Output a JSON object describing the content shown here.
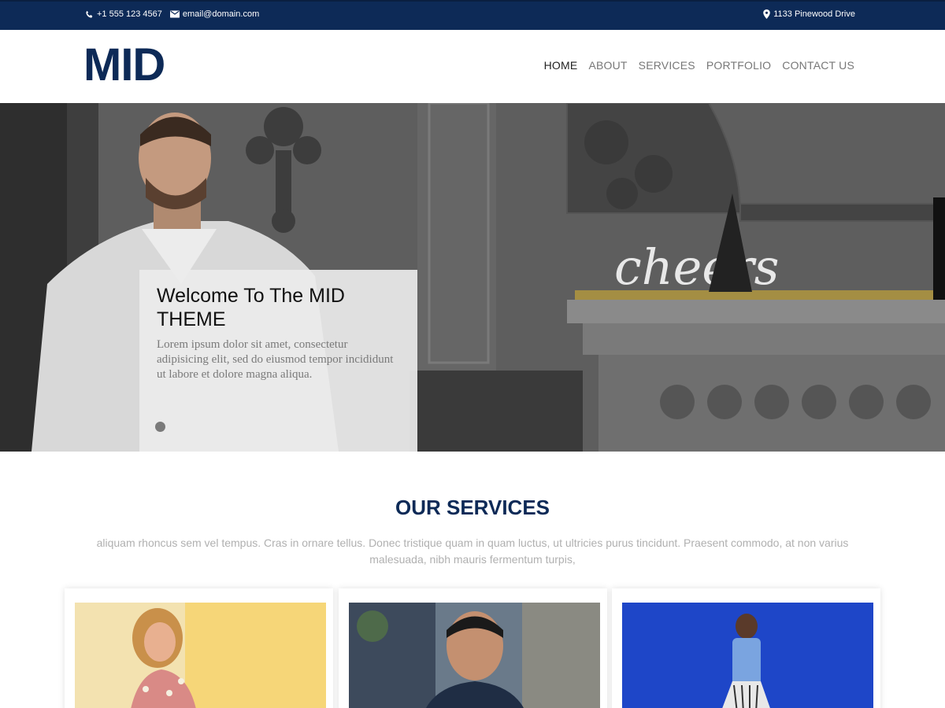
{
  "topbar": {
    "phone": "+1 555 123 4567",
    "email": "email@domain.com",
    "address": "1133 Pinewood Drive"
  },
  "header": {
    "logo": "MID",
    "nav": [
      "HOME",
      "ABOUT",
      "SERVICES",
      "PORTFOLIO",
      "CONTACT US"
    ],
    "active_nav": "HOME"
  },
  "hero": {
    "title": "Welcome To The MID THEME",
    "text": "Lorem ipsum dolor sit amet, consectetur adipisicing elit, sed do eiusmod tempor incididunt ut labore et dolore magna aliqua."
  },
  "services": {
    "title": "OUR SERVICES",
    "description": "aliquam rhoncus sem vel tempus. Cras in ornare tellus. Donec tristique quam in quam luctus, ut ultricies purus tincidunt. Praesent commodo, at non varius malesuada, nibh mauris fermentum turpis,"
  },
  "colors": {
    "brand": "#0d2a57",
    "topbar": "#0d2a57"
  },
  "icons": {
    "phone": "phone-icon",
    "email": "envelope-icon",
    "address": "map-marker-icon"
  }
}
